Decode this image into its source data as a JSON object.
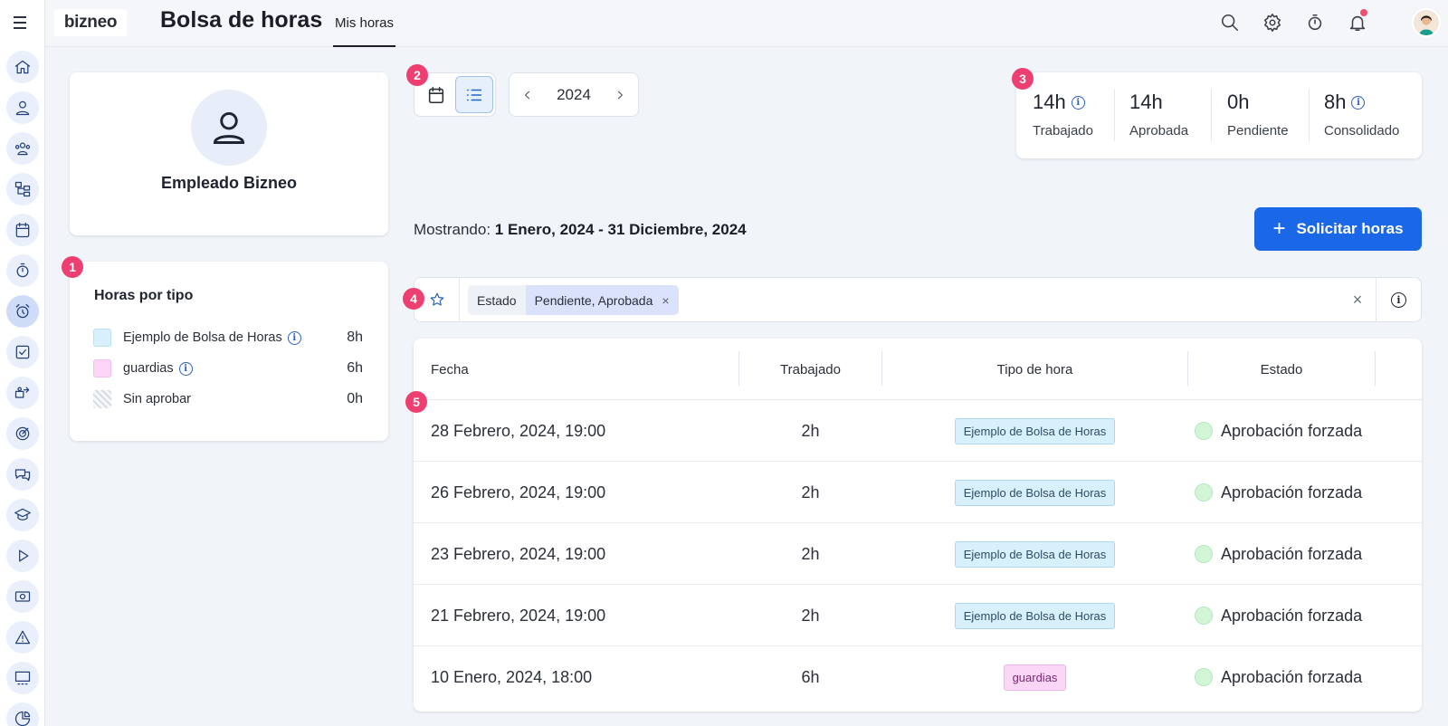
{
  "brand": {
    "logo_text": "bizneo"
  },
  "header": {
    "title": "Bolsa de horas",
    "tab": "Mis horas"
  },
  "top_icons": [
    "search-icon",
    "gear-icon",
    "stopwatch-icon",
    "bell-icon"
  ],
  "sidebar": {
    "items": [
      "home-icon",
      "user-icon",
      "users-icon",
      "org-chart-icon",
      "calendar-icon",
      "stopwatch-icon",
      "alarm-clock-icon",
      "checkbox-icon",
      "transfer-icon",
      "target-icon",
      "chat-icon",
      "graduation-cap-icon",
      "play-icon",
      "money-icon",
      "warning-icon",
      "presentation-icon",
      "pie-chart-icon"
    ],
    "active_index": 6
  },
  "profile": {
    "name": "Empleado Bizneo"
  },
  "hours_by_type": {
    "title": "Horas por tipo",
    "rows": [
      {
        "label": "Ejemplo de Bolsa de Horas",
        "value": "8h",
        "color": "#d8f0fb",
        "info": true
      },
      {
        "label": "guardias",
        "value": "6h",
        "color": "#fbd6f7",
        "info": true
      },
      {
        "label": "Sin aprobar",
        "value": "0h",
        "color": "hatched",
        "info": false
      }
    ]
  },
  "step_badges": [
    "1",
    "2",
    "3",
    "4",
    "5"
  ],
  "year_nav": {
    "year": "2024"
  },
  "stats": [
    {
      "value": "14h",
      "label": "Trabajado",
      "info": true
    },
    {
      "value": "14h",
      "label": "Aprobada",
      "info": false
    },
    {
      "value": "0h",
      "label": "Pendiente",
      "info": false
    },
    {
      "value": "8h",
      "label": "Consolidado",
      "info": true
    }
  ],
  "showing": {
    "prefix": "Mostrando:",
    "range": "1 Enero, 2024 - 31 Diciembre, 2024"
  },
  "request_button": {
    "label": "Solicitar horas"
  },
  "filter": {
    "key": "Estado",
    "value": "Pendiente, Aprobada",
    "remove": "×",
    "clear": "×"
  },
  "table": {
    "headers": [
      "Fecha",
      "Trabajado",
      "Tipo de hora",
      "Estado"
    ],
    "rows": [
      {
        "date": "28 Febrero, 2024, 19:00",
        "worked": "2h",
        "type": "Ejemplo de Bolsa de Horas",
        "type_kind": "bolsa",
        "status": "Aprobación forzada"
      },
      {
        "date": "26 Febrero, 2024, 19:00",
        "worked": "2h",
        "type": "Ejemplo de Bolsa de Horas",
        "type_kind": "bolsa",
        "status": "Aprobación forzada"
      },
      {
        "date": "23 Febrero, 2024, 19:00",
        "worked": "2h",
        "type": "Ejemplo de Bolsa de Horas",
        "type_kind": "bolsa",
        "status": "Aprobación forzada"
      },
      {
        "date": "21 Febrero, 2024, 19:00",
        "worked": "2h",
        "type": "Ejemplo de Bolsa de Horas",
        "type_kind": "bolsa",
        "status": "Aprobación forzada"
      },
      {
        "date": "10 Enero, 2024, 18:00",
        "worked": "6h",
        "type": "guardias",
        "type_kind": "guardias",
        "status": "Aprobación forzada"
      }
    ]
  },
  "colors": {
    "accent": "#1a67e8",
    "badge": "#ee3f71",
    "status_ok": "#d2f5d6"
  }
}
